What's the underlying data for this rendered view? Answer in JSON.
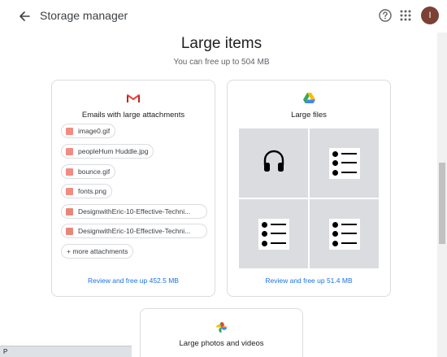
{
  "header": {
    "title": "Storage manager",
    "avatar_initial": "I"
  },
  "section": {
    "title": "Large items",
    "subtitle": "You can free up to 504 MB"
  },
  "email_card": {
    "label": "Emails with large attachments",
    "attachments": [
      {
        "name": "image0.gif",
        "type": "image"
      },
      {
        "name": "peopleHum Huddle.jpg",
        "type": "image"
      },
      {
        "name": "bounce.gif",
        "type": "image"
      },
      {
        "name": "fonts.png",
        "type": "image"
      },
      {
        "name": "DesignwithEric-10-Effective-Techni...",
        "type": "pdf"
      },
      {
        "name": "DesignwithEric-10-Effective-Techni...",
        "type": "pdf"
      }
    ],
    "more_label": "+ more attachments",
    "review_label": "Review and free up 452.5 MB"
  },
  "files_card": {
    "label": "Large files",
    "review_label": "Review and free up 51.4 MB"
  },
  "photos_card": {
    "label": "Large photos and videos"
  },
  "status_bar": {
    "text": "P"
  },
  "colors": {
    "link": "#1a73e8",
    "avatar_bg": "#7b4135",
    "tile_bg": "#dadce0"
  }
}
